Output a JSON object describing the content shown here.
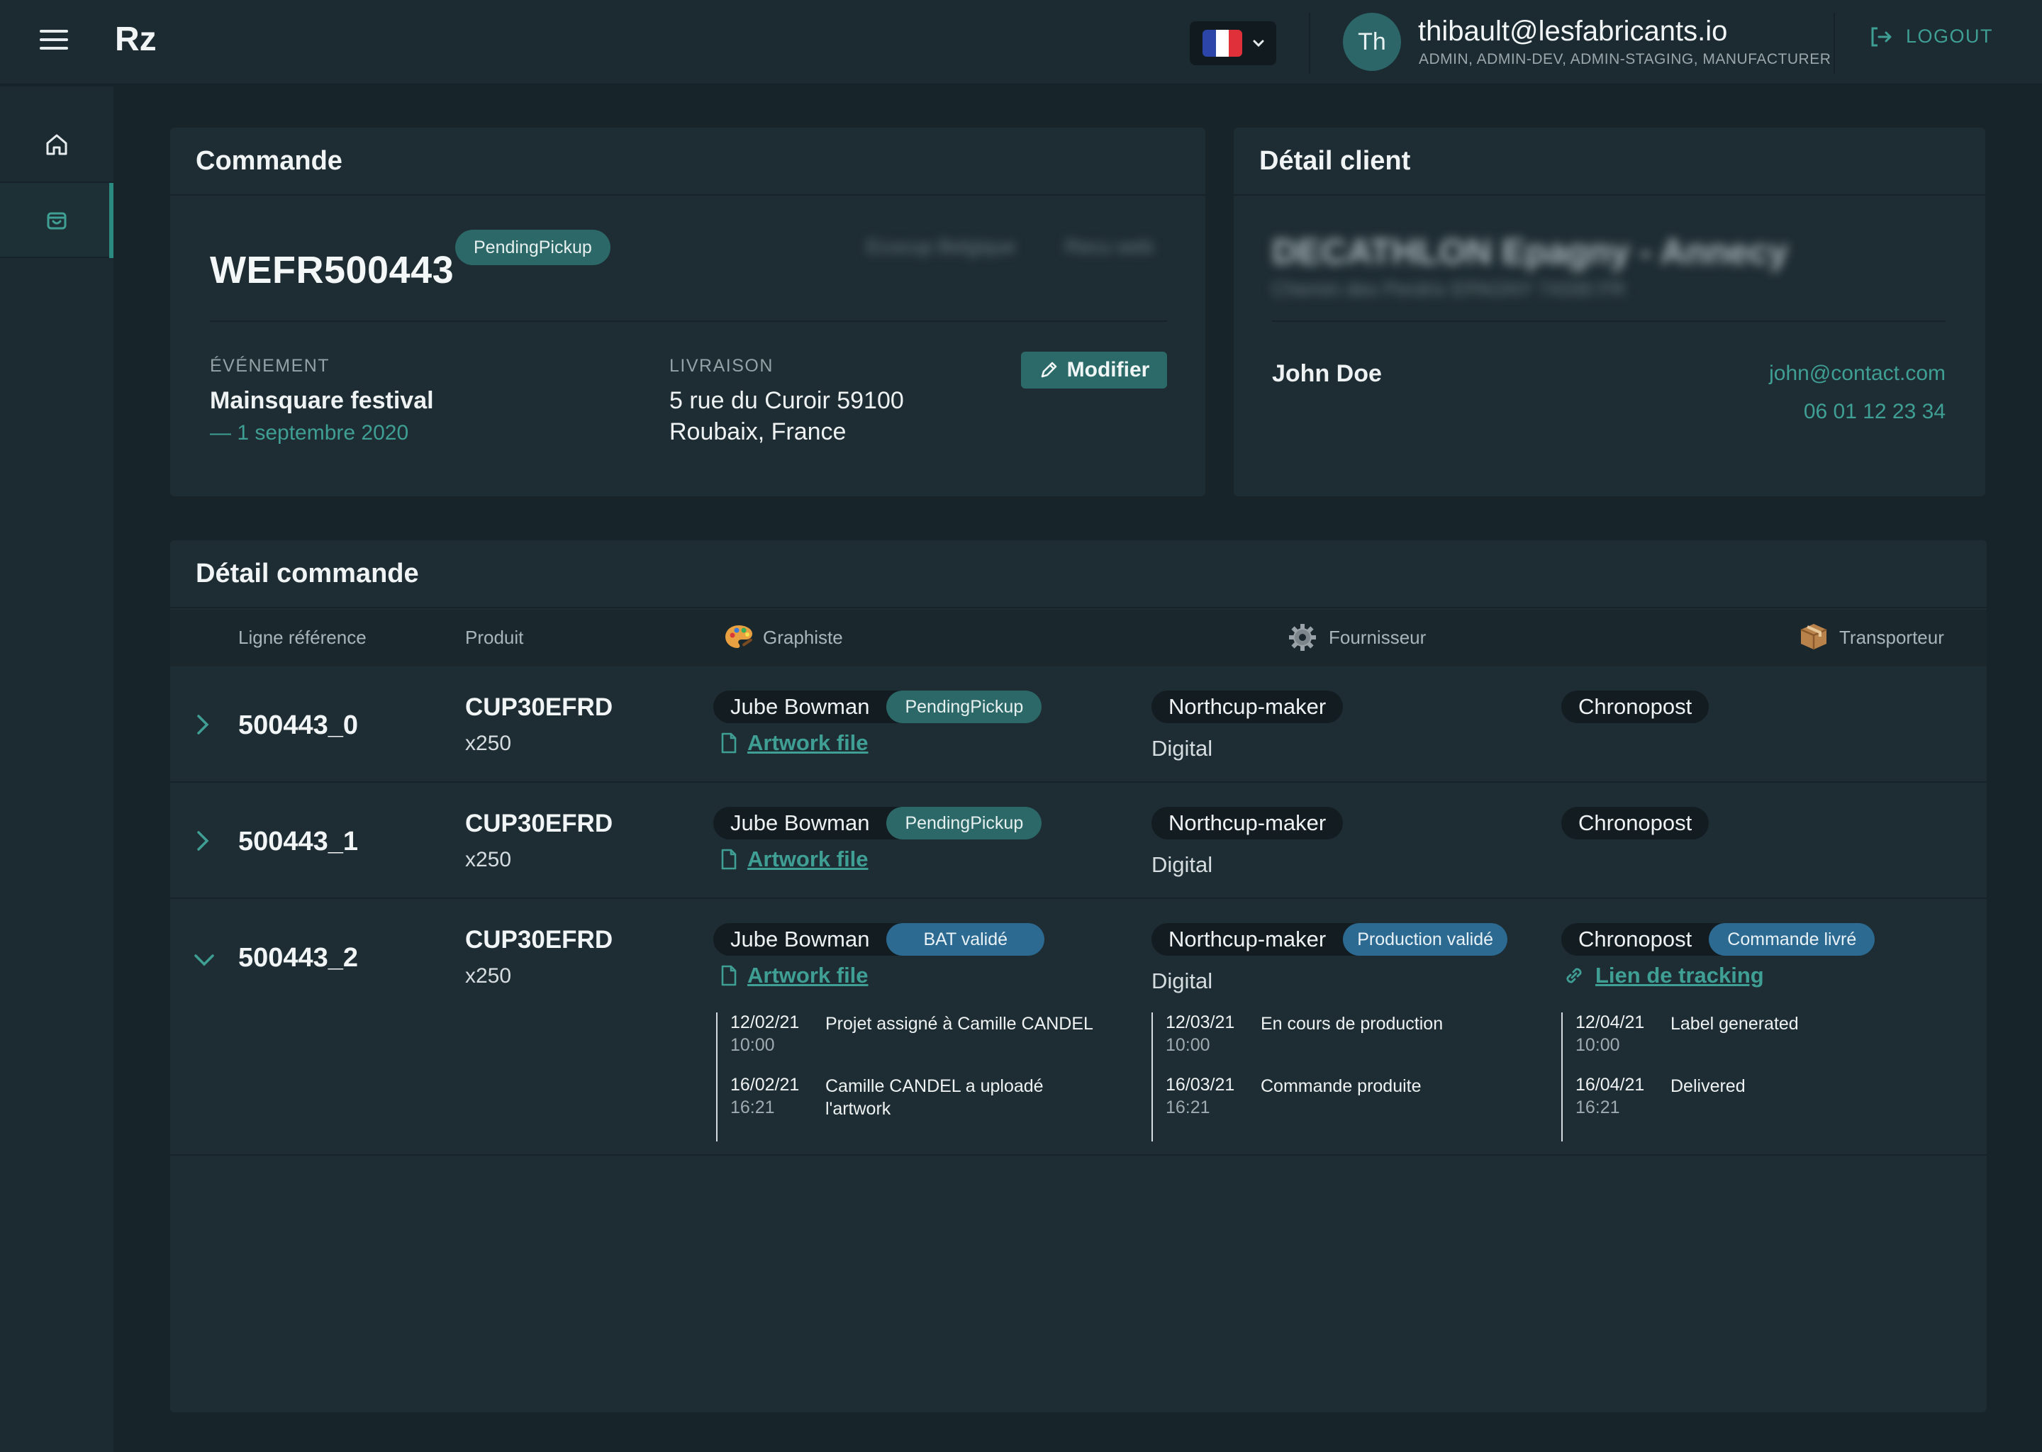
{
  "header": {
    "logo": "Rz",
    "language": "fr",
    "avatar_initials": "Th",
    "user_email": "thibault@lesfabricants.io",
    "user_roles": "ADMIN, ADMIN-DEV, ADMIN-STAGING, MANUFACTURER",
    "logout_label": "LOGOUT"
  },
  "sidebar": {
    "items": [
      {
        "icon": "home-icon",
        "active": false
      },
      {
        "icon": "shopping-bag-icon",
        "active": true
      }
    ]
  },
  "order": {
    "title": "Commande",
    "number": "WEFR500443",
    "status": "PendingPickup",
    "blurred_tag_1": "Ecocup Belgique",
    "blurred_tag_2": "Recu web",
    "event_label": "ÉVÉNEMENT",
    "event_name": "Mainsquare festival",
    "event_date": "— 1 septembre 2020",
    "delivery_label": "LIVRAISON",
    "delivery_line1": "5 rue du Curoir 59100",
    "delivery_line2": "Roubaix, France",
    "edit_label": "Modifier"
  },
  "client": {
    "title": "Détail client",
    "company": "DECATHLON Epagny - Annecy",
    "company_address": "Chemin des Perdrix EPAGNY 74330 FR",
    "contact_name": "John Doe",
    "contact_email": "john@contact.com",
    "contact_phone": "06 01 12 23 34"
  },
  "details": {
    "title": "Détail commande",
    "columns": {
      "ref": "Ligne référence",
      "product": "Produit",
      "designer": "Graphiste",
      "supplier": "Fournisseur",
      "carrier": "Transporteur"
    },
    "rows": [
      {
        "ref": "500443_0",
        "product": "CUP30EFRD",
        "qty": "x250",
        "designer": "Jube Bowman",
        "designer_status": "PendingPickup",
        "artwork": "Artwork file",
        "supplier": "Northcup-maker",
        "supplier_type": "Digital",
        "carrier": "Chronopost",
        "expanded": false
      },
      {
        "ref": "500443_1",
        "product": "CUP30EFRD",
        "qty": "x250",
        "designer": "Jube Bowman",
        "designer_status": "PendingPickup",
        "artwork": "Artwork file",
        "supplier": "Northcup-maker",
        "supplier_type": "Digital",
        "carrier": "Chronopost",
        "expanded": false
      },
      {
        "ref": "500443_2",
        "product": "CUP30EFRD",
        "qty": "x250",
        "designer": "Jube Bowman",
        "designer_status": "BAT validé",
        "artwork": "Artwork file",
        "supplier": "Northcup-maker",
        "supplier_status": "Production validé",
        "supplier_type": "Digital",
        "carrier": "Chronopost",
        "carrier_status": "Commande livré",
        "tracking": "Lien de tracking",
        "expanded": true,
        "designer_events": [
          {
            "date": "12/02/21",
            "time": "10:00",
            "text": "Projet assigné à Camille CANDEL"
          },
          {
            "date": "16/02/21",
            "time": "16:21",
            "text": "Camille CANDEL a uploadé l'artwork"
          }
        ],
        "supplier_events": [
          {
            "date": "12/03/21",
            "time": "10:00",
            "text": "En cours de production"
          },
          {
            "date": "16/03/21",
            "time": "16:21",
            "text": "Commande produite"
          }
        ],
        "carrier_events": [
          {
            "date": "12/04/21",
            "time": "10:00",
            "text": "Label generated"
          },
          {
            "date": "16/04/21",
            "time": "16:21",
            "text": "Delivered"
          }
        ]
      }
    ]
  },
  "colors": {
    "background": "#172429",
    "panel": "#1e2d33",
    "accent": "#3f9f94",
    "pill_teal": "#2c6868",
    "pill_blue": "#2c6a91"
  }
}
